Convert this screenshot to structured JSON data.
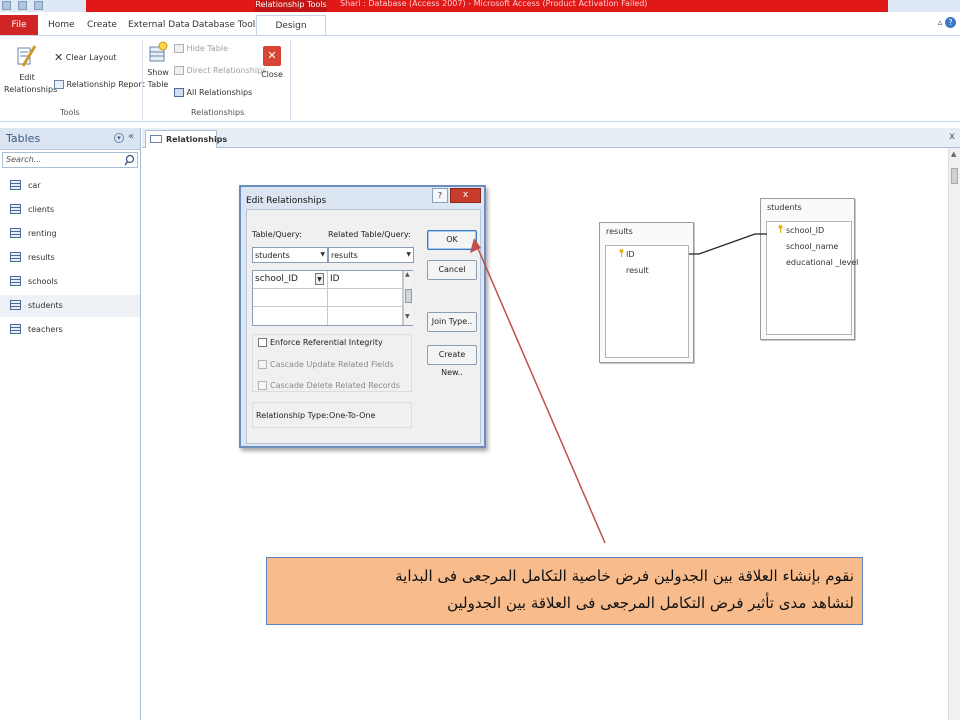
{
  "titlebar": {
    "context_tab": "Relationship Tools",
    "title": "Shari : Database (Access 2007) - Microsoft Access (Product Activation Failed)"
  },
  "ribbon_tabs": [
    "File",
    "Home",
    "Create",
    "External Data",
    "Database Tools",
    "Design"
  ],
  "ribbon": {
    "edit_relationships": "Edit Relationships",
    "clear_layout": "Clear Layout",
    "relationship_report": "Relationship Report",
    "tools_group": "Tools",
    "show_table": "Show Table",
    "hide_table": "Hide Table",
    "direct_relationships": "Direct Relationships",
    "all_relationships": "All Relationships",
    "relationships_group": "Relationships",
    "close": "Close"
  },
  "nav": {
    "title": "Tables",
    "search_placeholder": "Search...",
    "items": [
      "car",
      "clients",
      "renting",
      "results",
      "schools",
      "students",
      "teachers"
    ],
    "selected": "students"
  },
  "doc_tab": "Relationships",
  "tables": {
    "results": {
      "title": "results",
      "fields": [
        "ID",
        "result"
      ]
    },
    "students": {
      "title": "students",
      "fields": [
        "school_ID",
        "school_name",
        "educational _level"
      ]
    }
  },
  "dialog": {
    "title": "Edit Relationships",
    "help": "?",
    "close": "x",
    "table_query_label": "Table/Query:",
    "related_label": "Related Table/Query:",
    "table_query_value": "students",
    "related_value": "results",
    "field_left": "school_ID",
    "field_right": "ID",
    "ok": "OK",
    "cancel": "Cancel",
    "join_type": "Join Type..",
    "create_new": "Create New..",
    "enforce": "Enforce Referential Integrity",
    "cascade_update": "Cascade Update Related Fields",
    "cascade_delete": "Cascade Delete Related Records",
    "relationship_type_label": "Relationship Type:",
    "relationship_type_value": "One-To-One"
  },
  "annotation": {
    "line1": "نقوم بإنشاء العلاقة بين الجدولين فرض خاصية التكامل المرجعى فى البداية",
    "line2": "لنشاهد مدى تأثير فرض التكامل المرجعى فى العلاقة بين الجدولين"
  },
  "colors": {
    "accent_red": "#e01818",
    "file_tab": "#d02525",
    "dialog_bg": "#dce6f3",
    "note_bg": "#f8bc8c",
    "arrow": "#c0504d"
  }
}
